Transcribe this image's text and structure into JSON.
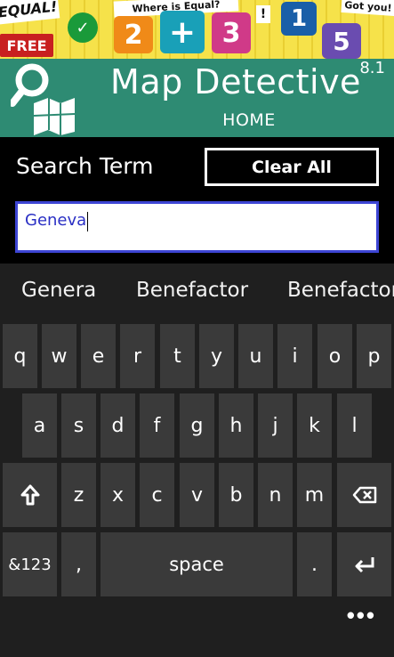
{
  "app": {
    "title": "Map Detective",
    "version": "8.1",
    "screen": "HOME"
  },
  "banner": {
    "items": [
      "EQUAL!",
      "FREE",
      "Where is Equal?",
      "2",
      "+",
      "3",
      "1",
      "5",
      "Got you!",
      "!"
    ]
  },
  "search": {
    "label": "Search Term",
    "value": "Geneva",
    "clear_label": "Clear All"
  },
  "keyboard": {
    "suggestions": [
      "Genera",
      "Benefactor",
      "Benefactor"
    ],
    "row1": [
      "q",
      "w",
      "e",
      "r",
      "t",
      "y",
      "u",
      "i",
      "o",
      "p"
    ],
    "row2": [
      "a",
      "s",
      "d",
      "f",
      "g",
      "h",
      "j",
      "k",
      "l"
    ],
    "row3": [
      "z",
      "x",
      "c",
      "v",
      "b",
      "n",
      "m"
    ],
    "symbols_label": "&123",
    "comma_label": ",",
    "space_label": "space",
    "period_label": ".",
    "more_label": "•••"
  },
  "colors": {
    "header_bg": "#2e8b73",
    "input_border": "#3d45d4",
    "key_bg": "#3a3a3a",
    "keyboard_bg": "#1f1f1f"
  },
  "icons": [
    "magnifier-map-logo-icon",
    "shift-arrow-icon",
    "backspace-icon",
    "enter-icon"
  ]
}
